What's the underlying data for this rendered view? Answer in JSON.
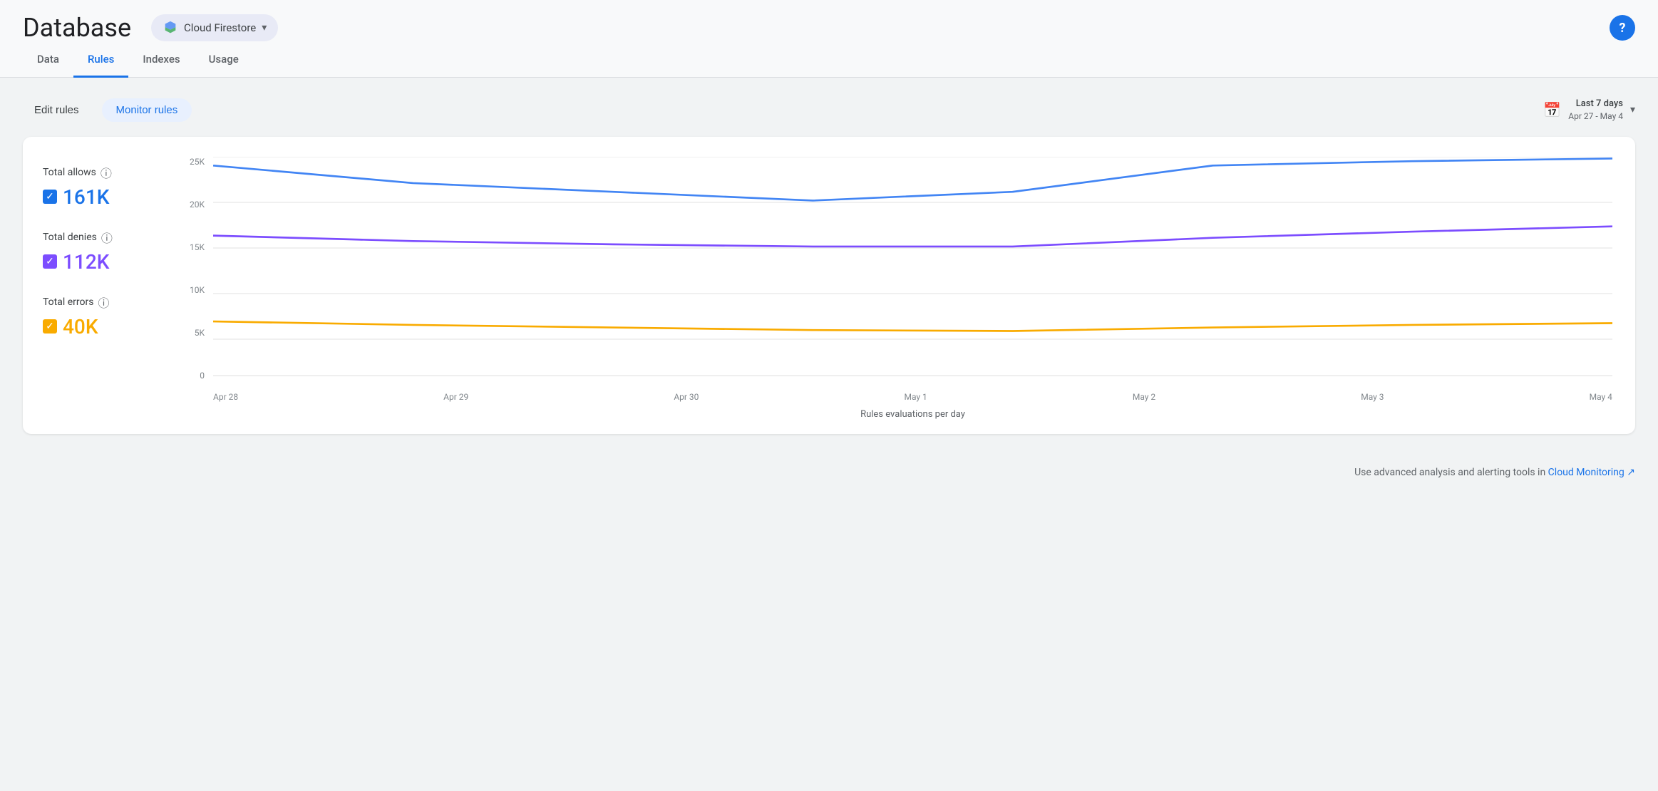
{
  "header": {
    "title": "Database",
    "service": {
      "name": "Cloud Firestore",
      "icon": "firestore-icon"
    },
    "help_label": "?"
  },
  "tabs": [
    {
      "id": "data",
      "label": "Data",
      "active": false
    },
    {
      "id": "rules",
      "label": "Rules",
      "active": true
    },
    {
      "id": "indexes",
      "label": "Indexes",
      "active": false
    },
    {
      "id": "usage",
      "label": "Usage",
      "active": false
    }
  ],
  "toolbar": {
    "edit_rules_label": "Edit rules",
    "monitor_rules_label": "Monitor rules",
    "date_range_label": "Last 7 days",
    "date_range_sub": "Apr 27 - May 4"
  },
  "legend": {
    "allows": {
      "label": "Total allows",
      "value": "161K",
      "color": "blue"
    },
    "denies": {
      "label": "Total denies",
      "value": "112K",
      "color": "purple"
    },
    "errors": {
      "label": "Total errors",
      "value": "40K",
      "color": "yellow"
    }
  },
  "chart": {
    "y_labels": [
      "25K",
      "20K",
      "15K",
      "10K",
      "5K",
      "0"
    ],
    "x_labels": [
      "Apr 28",
      "Apr 29",
      "Apr 30",
      "May 1",
      "May 2",
      "May 3",
      "May 4"
    ],
    "x_label": "Rules evaluations per day",
    "lines": {
      "blue": {
        "color": "#4285f4",
        "points": [
          24000,
          22000,
          21500,
          21000,
          21500,
          24000,
          24500,
          24800
        ]
      },
      "purple": {
        "color": "#7c4dff",
        "points": [
          16000,
          15500,
          15200,
          15000,
          15000,
          15800,
          16500,
          17000
        ]
      },
      "yellow": {
        "color": "#f9ab00",
        "points": [
          6200,
          5800,
          5500,
          5200,
          5100,
          5500,
          5800,
          6000
        ]
      }
    }
  },
  "footer": {
    "text": "Use advanced analysis and alerting tools in ",
    "link_label": "Cloud Monitoring",
    "link_icon": "external-link-icon"
  }
}
